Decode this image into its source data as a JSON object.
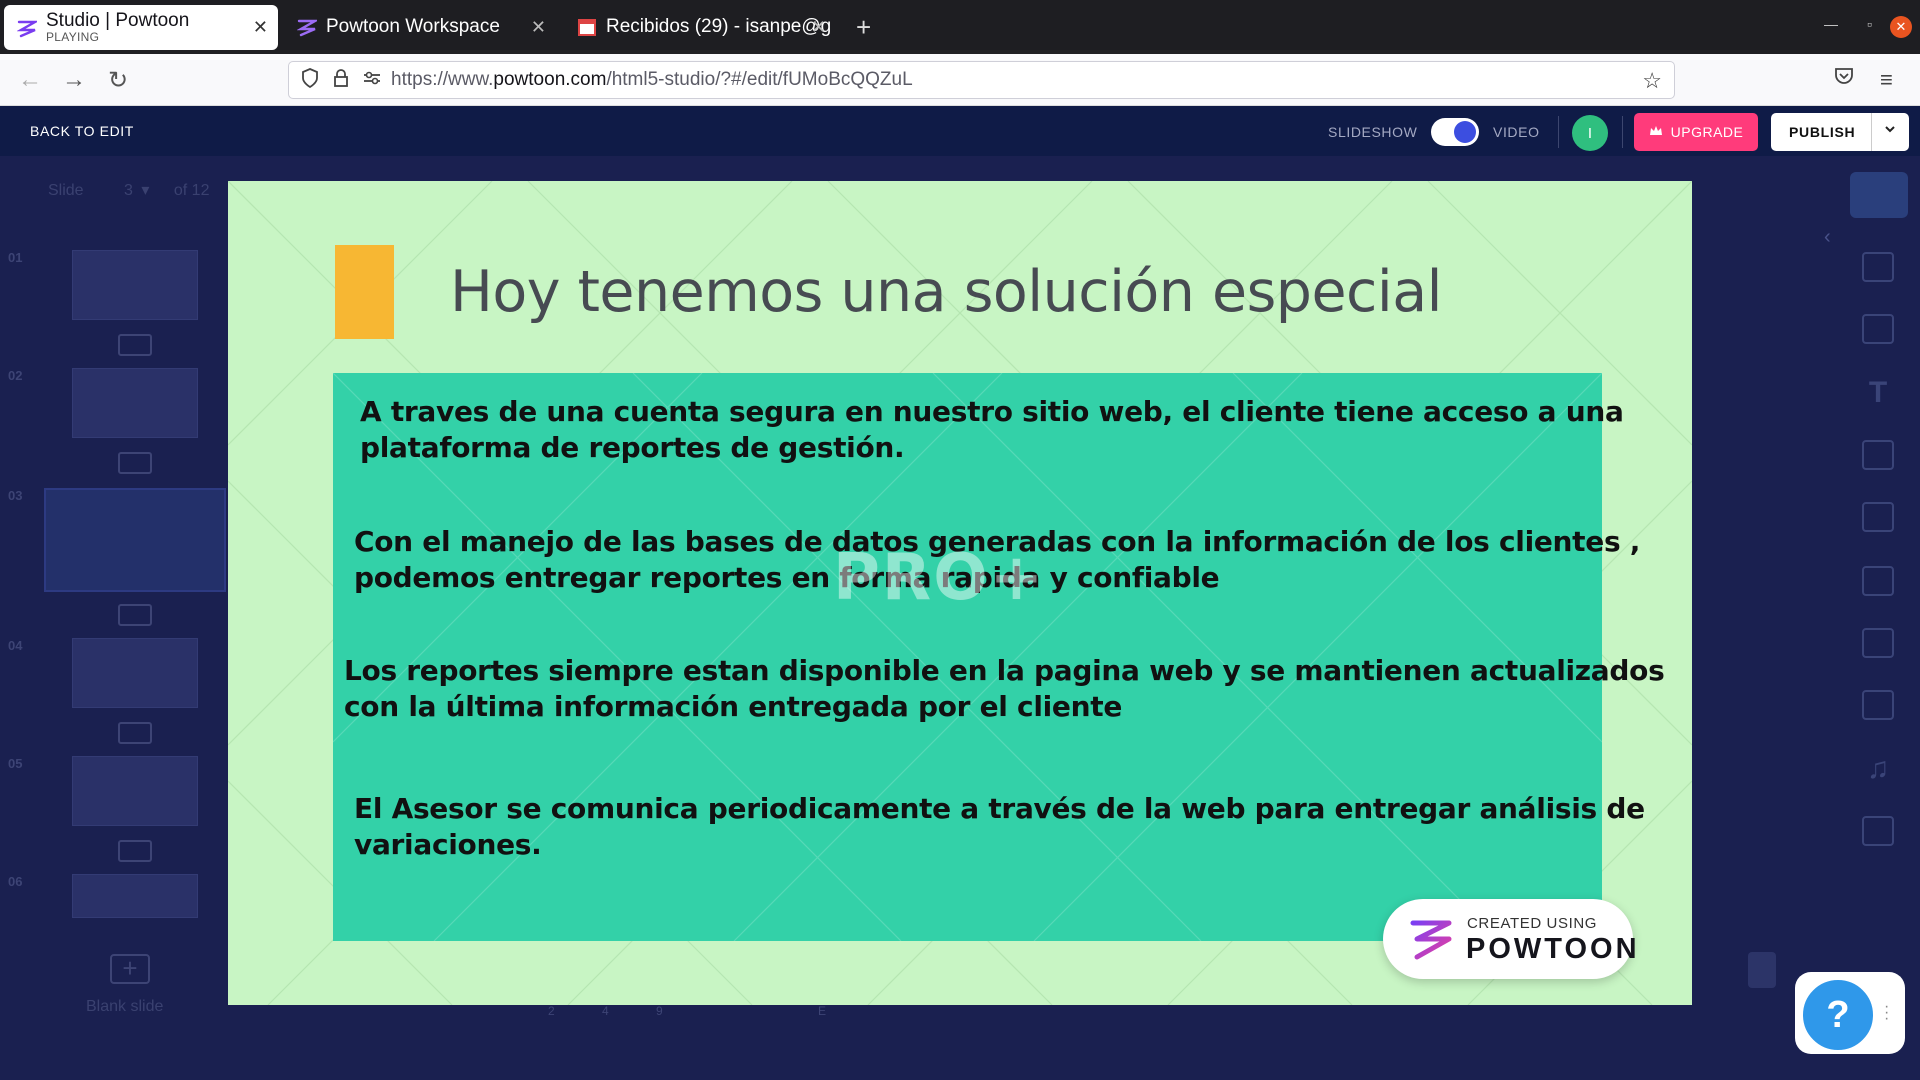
{
  "browser": {
    "tabs": [
      {
        "title": "Studio | Powtoon",
        "subtitle": "PLAYING",
        "active": true
      },
      {
        "title": "Powtoon Workspace",
        "active": false
      },
      {
        "title": "Recibidos (29) - isanpe@g",
        "active": false
      }
    ],
    "url_prefix": "https://www.",
    "url_host": "powtoon.com",
    "url_path": "/html5-studio/?#/edit/fUMoBcQQZuL"
  },
  "header": {
    "back_label": "BACK TO EDIT",
    "mode_slideshow": "SLIDESHOW",
    "mode_video": "VIDEO",
    "avatar_initial": "I",
    "upgrade_label": "UPGRADE",
    "publish_label": "PUBLISH"
  },
  "editor": {
    "slide_label": "Slide",
    "slide_current": "3",
    "slide_total": "of 12",
    "thumb_numbers": [
      "01",
      "02",
      "03",
      "04",
      "05",
      "06"
    ],
    "blank_slide_label": "Blank slide",
    "timeline_marks": [
      "2",
      "4",
      "9",
      "E"
    ]
  },
  "slide": {
    "title": "Hoy tenemos una  solución especial",
    "bullets": [
      {
        "line1": "A traves de una cuenta segura en nuestro sitio web, el cliente   tiene acceso a una",
        "line2": "plataforma de reportes de gestión."
      },
      {
        "line1": "Con el manejo de las bases de datos generadas con la información de los clientes ,",
        "line2": "podemos entregar reportes en forma rapida y confiable"
      },
      {
        "line1": "Los reportes siempre estan disponible en la pagina web y se mantienen actualizados",
        "line2": "con la última información entregada por el cliente"
      },
      {
        "line1": "El Asesor se comunica periodicamente a través de la web para entregar análisis de",
        "line2": "variaciones."
      }
    ],
    "watermark": "PRO+",
    "badge_small": "CREATED USING",
    "badge_big": "POWTOON",
    "colors": {
      "background": "#c8f5c4",
      "box": "#33d1a8",
      "accent": "#f7b733"
    }
  },
  "help": {
    "label": "?"
  }
}
